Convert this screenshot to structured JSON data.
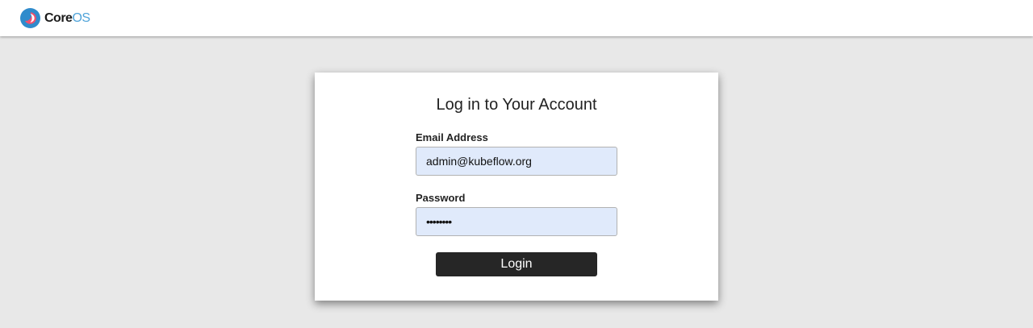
{
  "header": {
    "logo": {
      "icon": "coreos-logo-icon",
      "text_core": "Core",
      "text_os": "OS",
      "colors": {
        "ring": "#2f8bcc",
        "flame": "#f0506e",
        "os_text": "#4fa3d9"
      }
    }
  },
  "login": {
    "title": "Log in to Your Account",
    "email_label": "Email Address",
    "email_value": "admin@kubeflow.org",
    "password_label": "Password",
    "password_value": "••••••••",
    "login_button": "Login"
  },
  "colors": {
    "background": "#e8e8e8",
    "input_fill": "#e0eafb",
    "button": "#262626"
  }
}
